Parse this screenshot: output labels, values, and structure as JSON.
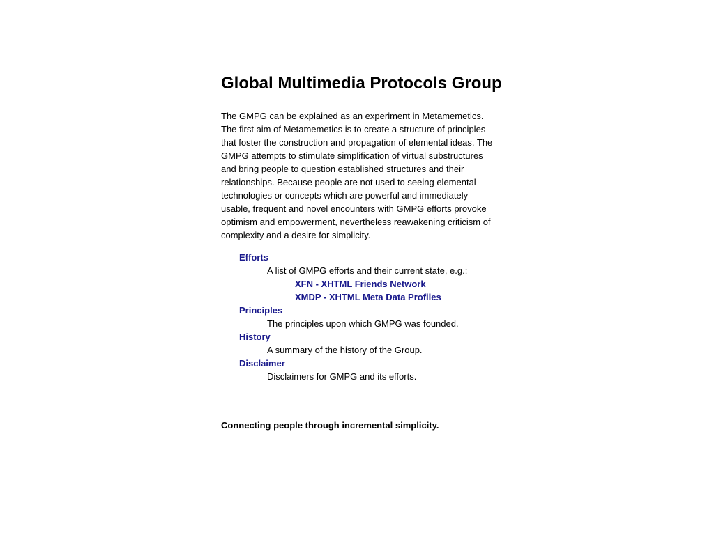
{
  "page": {
    "title": "Global Multimedia Protocols Group",
    "intro": "The GMPG can be explained as an experiment in Metamemetics. The first aim of Metamemetics is to create a structure of principles that foster the construction and propagation of elemental ideas. The GMPG attempts to stimulate simplification of virtual substructures and bring people to question established structures and their relationships. Because people are not used to seeing elemental technologies or concepts which are powerful and immediately usable, frequent and novel encounters with GMPG efforts provoke optimism and empowerment, nevertheless reawakening criticism of complexity and a desire for simplicity.",
    "tagline": "Connecting people through incremental simplicity."
  },
  "sections": {
    "efforts": {
      "label": "Efforts",
      "description": "A list of GMPG efforts and their current state, e.g.:",
      "links": [
        {
          "label": "XFN - XHTML Friends Network"
        },
        {
          "label": "XMDP - XHTML Meta Data Profiles"
        }
      ]
    },
    "principles": {
      "label": "Principles",
      "description": "The principles upon which GMPG was founded."
    },
    "history": {
      "label": "History",
      "description": "A summary of the history of the Group."
    },
    "disclaimer": {
      "label": "Disclaimer",
      "description": "Disclaimers for GMPG and its efforts."
    }
  },
  "colors": {
    "link": "#1a1a8c",
    "text": "#000000",
    "background": "#ffffff"
  }
}
